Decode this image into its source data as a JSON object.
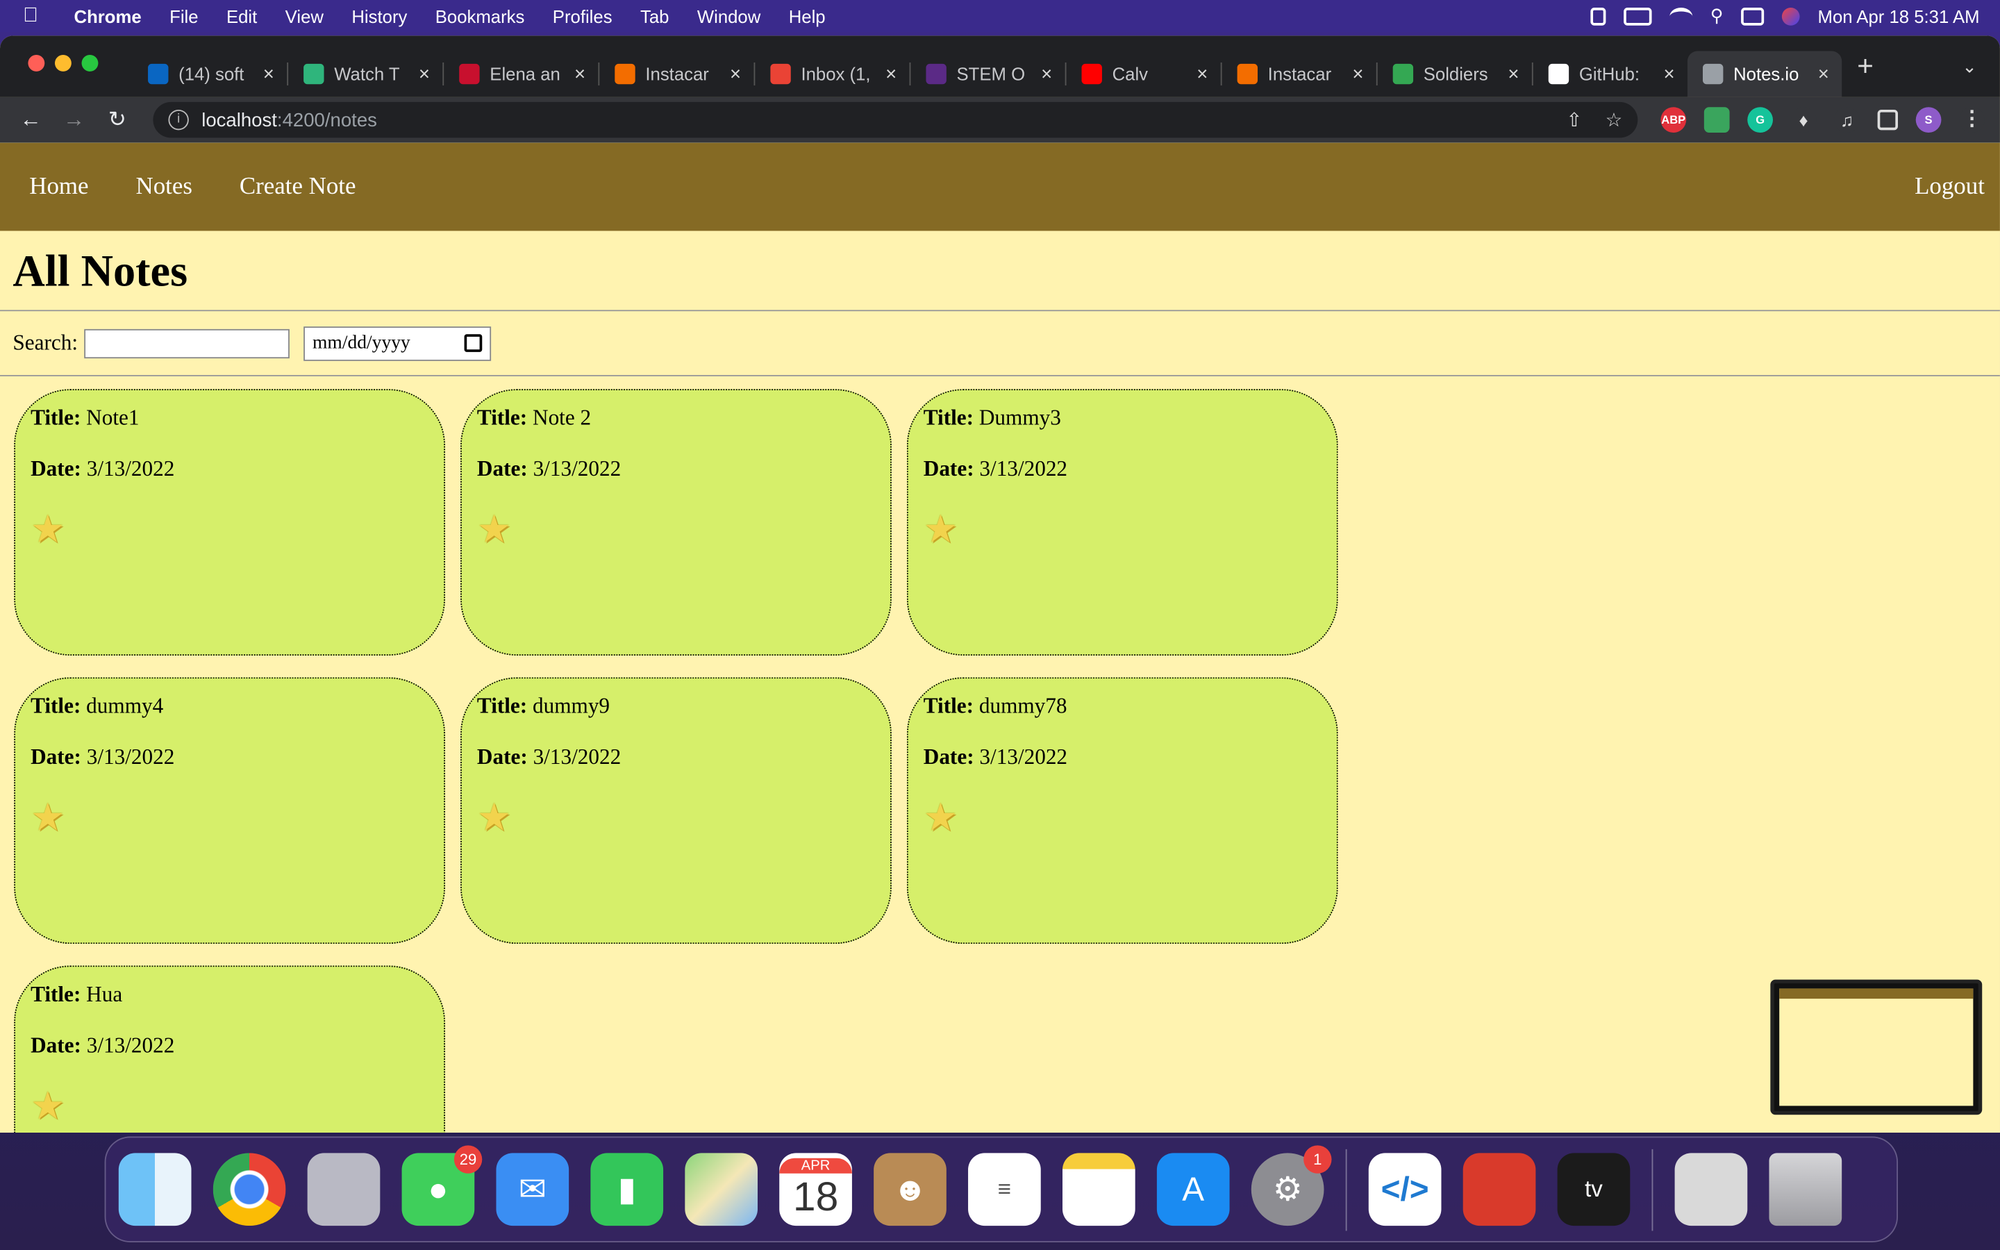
{
  "menubar": {
    "app": "Chrome",
    "items": [
      "File",
      "Edit",
      "View",
      "History",
      "Bookmarks",
      "Profiles",
      "Tab",
      "Window",
      "Help"
    ],
    "clock": "Mon Apr 18  5:31 AM"
  },
  "tabs": [
    {
      "title": "(14) soft",
      "icon": "linkedin-icon",
      "color": "#0a66c2"
    },
    {
      "title": "Watch T",
      "icon": "play-icon",
      "color": "#2fb57c"
    },
    {
      "title": "Elena an",
      "icon": "fleur-icon",
      "color": "#c8102e"
    },
    {
      "title": "Instacar",
      "icon": "carrot-icon",
      "color": "#f36d00"
    },
    {
      "title": "Inbox (1,",
      "icon": "gmail-icon",
      "color": "#ea4335"
    },
    {
      "title": "STEM O",
      "icon": "stem-icon",
      "color": "#5b2a86"
    },
    {
      "title": "Calv",
      "icon": "youtube-icon",
      "color": "#ff0000"
    },
    {
      "title": "Instacar",
      "icon": "carrot-icon",
      "color": "#f36d00"
    },
    {
      "title": "Soldiers",
      "icon": "maps-icon",
      "color": "#34a853"
    },
    {
      "title": "GitHub:",
      "icon": "github-icon",
      "color": "#ffffff"
    },
    {
      "title": "Notes.io",
      "icon": "globe-icon",
      "color": "#9aa0a6",
      "active": true
    }
  ],
  "address": {
    "host": "localhost",
    "path": ":4200/notes"
  },
  "nav": {
    "home": "Home",
    "notes": "Notes",
    "create": "Create Note",
    "logout": "Logout"
  },
  "page": {
    "title": "All Notes",
    "search_label": "Search:",
    "search_value": "",
    "date_placeholder": "mm/dd/yyyy"
  },
  "labels": {
    "title": "Title:",
    "date": "Date:"
  },
  "notes": [
    {
      "title": "Note1",
      "date": "3/13/2022"
    },
    {
      "title": "Note 2",
      "date": "3/13/2022"
    },
    {
      "title": "Dummy3",
      "date": "3/13/2022"
    },
    {
      "title": "dummy4",
      "date": "3/13/2022"
    },
    {
      "title": "dummy9",
      "date": "3/13/2022"
    },
    {
      "title": "dummy78",
      "date": "3/13/2022"
    },
    {
      "title": "Hua",
      "date": "3/13/2022"
    }
  ],
  "dock": {
    "messages_badge": "29",
    "settings_badge": "1",
    "calendar_month": "APR",
    "calendar_day": "18"
  }
}
